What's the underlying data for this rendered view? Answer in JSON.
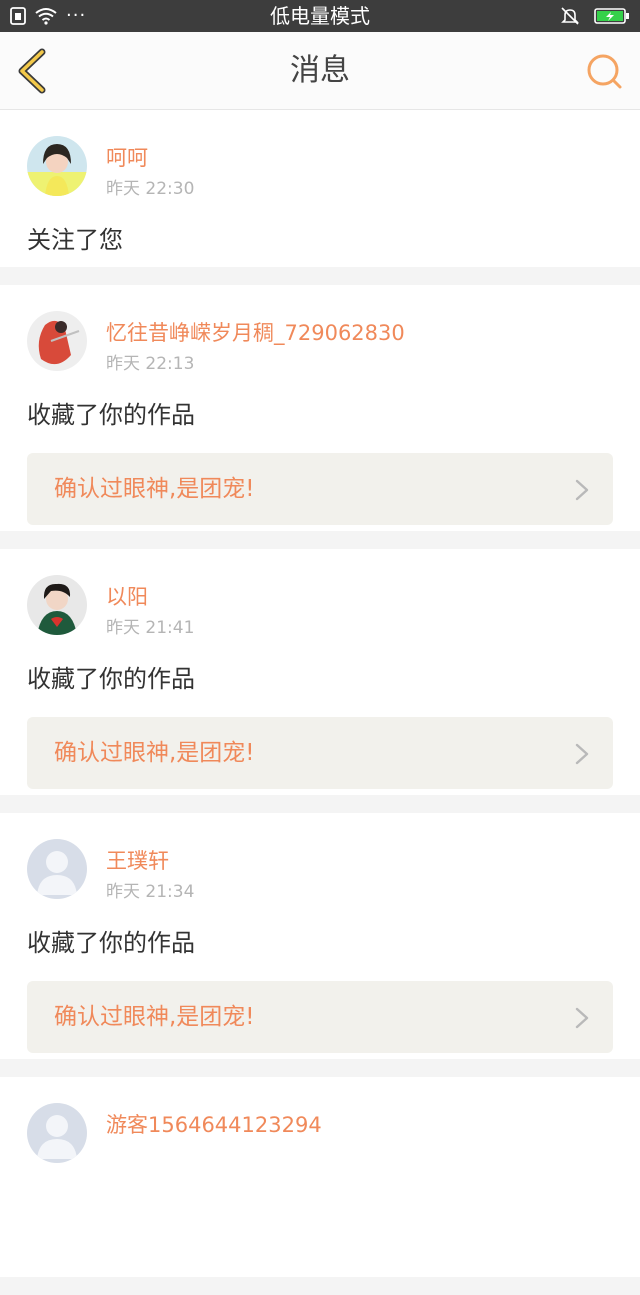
{
  "status_bar": {
    "title": "低电量模式",
    "dots": "···"
  },
  "nav": {
    "title": "消息",
    "back_icon": "chevron-left-icon",
    "search_icon": "search-icon"
  },
  "colors": {
    "accent": "#f0895a",
    "back_accent": "#f3c94a",
    "battery": "#35d14a"
  },
  "messages": [
    {
      "name": "呵呵",
      "time": "昨天 22:30",
      "action": "关注了您",
      "work": ""
    },
    {
      "name": "忆往昔峥嵘岁月稠_729062830",
      "time": "昨天 22:13",
      "action": "收藏了你的作品",
      "work": "确认过眼神,是团宠!"
    },
    {
      "name": "以阳",
      "time": "昨天 21:41",
      "action": "收藏了你的作品",
      "work": "确认过眼神,是团宠!"
    },
    {
      "name": "王璞轩",
      "time": "昨天 21:34",
      "action": "收藏了你的作品",
      "work": "确认过眼神,是团宠!"
    },
    {
      "name": "游客1564644123294",
      "time": "",
      "action": "",
      "work": ""
    }
  ]
}
